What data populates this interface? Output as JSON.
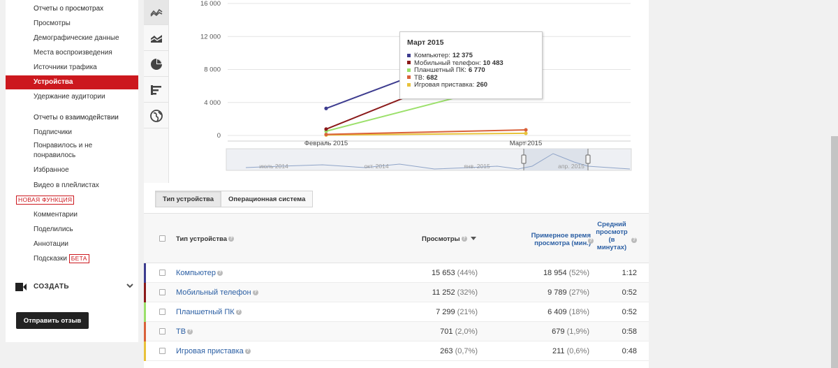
{
  "sidebar": {
    "items": [
      {
        "label": "Отчеты о просмотрах"
      },
      {
        "label": "Просмотры"
      },
      {
        "label": "Демографические данные"
      },
      {
        "label": "Места воспроизведения"
      },
      {
        "label": "Источники трафика"
      },
      {
        "label": "Устройства"
      },
      {
        "label": "Удержание аудитории"
      },
      {
        "label": "Отчеты о взаимодействии"
      },
      {
        "label": "Подписчики"
      },
      {
        "label": "Понравилось и не понравилось"
      },
      {
        "label": "Избранное"
      },
      {
        "label": "Видео в плейлистах"
      },
      {
        "label": "НОВАЯ ФУНКЦИЯ"
      },
      {
        "label": "Комментарии"
      },
      {
        "label": "Поделились"
      },
      {
        "label": "Аннотации"
      },
      {
        "label": "Подсказки",
        "badge": "БЕТА"
      }
    ],
    "create_label": "СОЗДАТЬ",
    "feedback_button": "Отправить отзыв"
  },
  "chart_tools": [
    "line-chart-icon",
    "area-chart-icon",
    "pie-chart-icon",
    "bar-chart-icon",
    "globe-icon"
  ],
  "chart_data": {
    "type": "line",
    "x": [
      "Февраль 2015",
      "Март 2015"
    ],
    "ylim": [
      0,
      16000
    ],
    "yticks": [
      "16 000",
      "12 000",
      "8 000",
      "4 000",
      "0"
    ],
    "series": [
      {
        "name": "Компьютер",
        "color": "#3d3c8f",
        "values": [
          3280,
          12375
        ]
      },
      {
        "name": "Мобильный телефон",
        "color": "#8b1a1a",
        "values": [
          770,
          10483
        ]
      },
      {
        "name": "Планшетный ПК",
        "color": "#9be06a",
        "values": [
          520,
          6770
        ]
      },
      {
        "name": "ТВ",
        "color": "#d9613a",
        "values": [
          130,
          682
        ]
      },
      {
        "name": "Игровая приставка",
        "color": "#e8c23a",
        "values": [
          60,
          260
        ]
      }
    ],
    "navigator_labels": [
      "июль 2014",
      "окт. 2014",
      "янв. 2015",
      "апр. 2015"
    ]
  },
  "tooltip": {
    "title": "Март 2015",
    "rows": [
      {
        "label": "Компьютер:",
        "value": "12 375",
        "color": "#3d3c8f"
      },
      {
        "label": "Мобильный телефон:",
        "value": "10 483",
        "color": "#8b1a1a"
      },
      {
        "label": "Планшетный ПК:",
        "value": "6 770",
        "color": "#9be06a"
      },
      {
        "label": "ТВ:",
        "value": "682",
        "color": "#d9613a"
      },
      {
        "label": "Игровая приставка:",
        "value": "260",
        "color": "#e8c23a"
      }
    ]
  },
  "tabs": [
    {
      "label": "Тип устройства"
    },
    {
      "label": "Операционная система"
    }
  ],
  "table": {
    "headers": {
      "type": "Тип устройства",
      "views": "Просмотры",
      "watch_time": "Примерное время просмотра (мин.)",
      "avg_duration": "Средний просмотр (в минутах)"
    },
    "rows": [
      {
        "name": "Компьютер",
        "views": "15 653",
        "views_pct": "(44%)",
        "time": "18 954",
        "time_pct": "(52%)",
        "avg": "1:12",
        "color": "#3d3c8f"
      },
      {
        "name": "Мобильный телефон",
        "views": "11 252",
        "views_pct": "(32%)",
        "time": "9 789",
        "time_pct": "(27%)",
        "avg": "0:52",
        "color": "#8b1a1a"
      },
      {
        "name": "Планшетный ПК",
        "views": "7 299",
        "views_pct": "(21%)",
        "time": "6 409",
        "time_pct": "(18%)",
        "avg": "0:52",
        "color": "#9be06a"
      },
      {
        "name": "ТВ",
        "views": "701",
        "views_pct": "(2,0%)",
        "time": "679",
        "time_pct": "(1,9%)",
        "avg": "0:58",
        "color": "#d9613a"
      },
      {
        "name": "Игровая приставка",
        "views": "263",
        "views_pct": "(0,7%)",
        "time": "211",
        "time_pct": "(0,6%)",
        "avg": "0:48",
        "color": "#e8c23a"
      }
    ]
  }
}
